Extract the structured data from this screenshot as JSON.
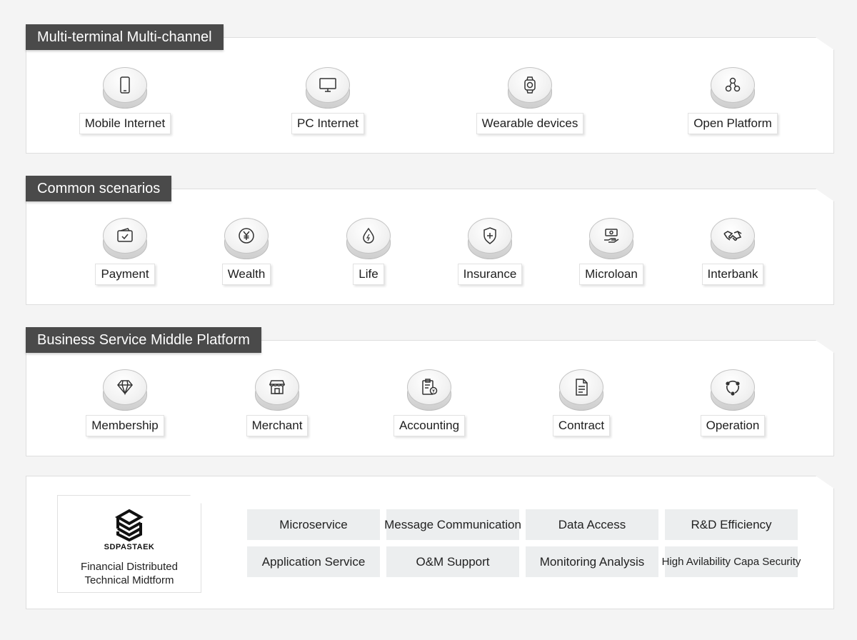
{
  "sections": [
    {
      "title": "Multi-terminal Multi-channel",
      "items": [
        {
          "label": "Mobile Internet",
          "icon": "mobile-phone-icon"
        },
        {
          "label": "PC Internet",
          "icon": "monitor-icon"
        },
        {
          "label": "Wearable devices",
          "icon": "smartwatch-icon"
        },
        {
          "label": "Open Platform",
          "icon": "network-nodes-icon"
        }
      ]
    },
    {
      "title": "Common scenarios",
      "items": [
        {
          "label": "Payment",
          "icon": "wallet-check-icon"
        },
        {
          "label": "Wealth",
          "icon": "yen-coin-icon"
        },
        {
          "label": "Life",
          "icon": "flame-drop-icon"
        },
        {
          "label": "Insurance",
          "icon": "shield-plus-icon"
        },
        {
          "label": "Microloan",
          "icon": "money-hand-icon"
        },
        {
          "label": "Interbank",
          "icon": "handshake-icon"
        }
      ]
    },
    {
      "title": "Business Service Middle Platform",
      "items": [
        {
          "label": "Membership",
          "icon": "diamond-icon"
        },
        {
          "label": "Merchant",
          "icon": "storefront-icon"
        },
        {
          "label": "Accounting",
          "icon": "clipboard-coin-icon"
        },
        {
          "label": "Contract",
          "icon": "document-icon"
        },
        {
          "label": "Operation",
          "icon": "cycle-arrows-icon"
        }
      ]
    }
  ],
  "tech_platform": {
    "brand": "SDPASTAEK",
    "caption": "Financial Distributed Technical Midtform",
    "capabilities": [
      "Microservice",
      "Message Communication",
      "Data Access",
      "R&D Efficiency",
      "Application Service",
      "O&M Support",
      "Monitoring Analysis",
      "High Avilability Capa Security"
    ]
  },
  "colors": {
    "header_bg": "#4a4a4a",
    "header_text": "#ffffff",
    "capability_bg": "#eceeef",
    "page_bg": "#f4f4f4"
  }
}
